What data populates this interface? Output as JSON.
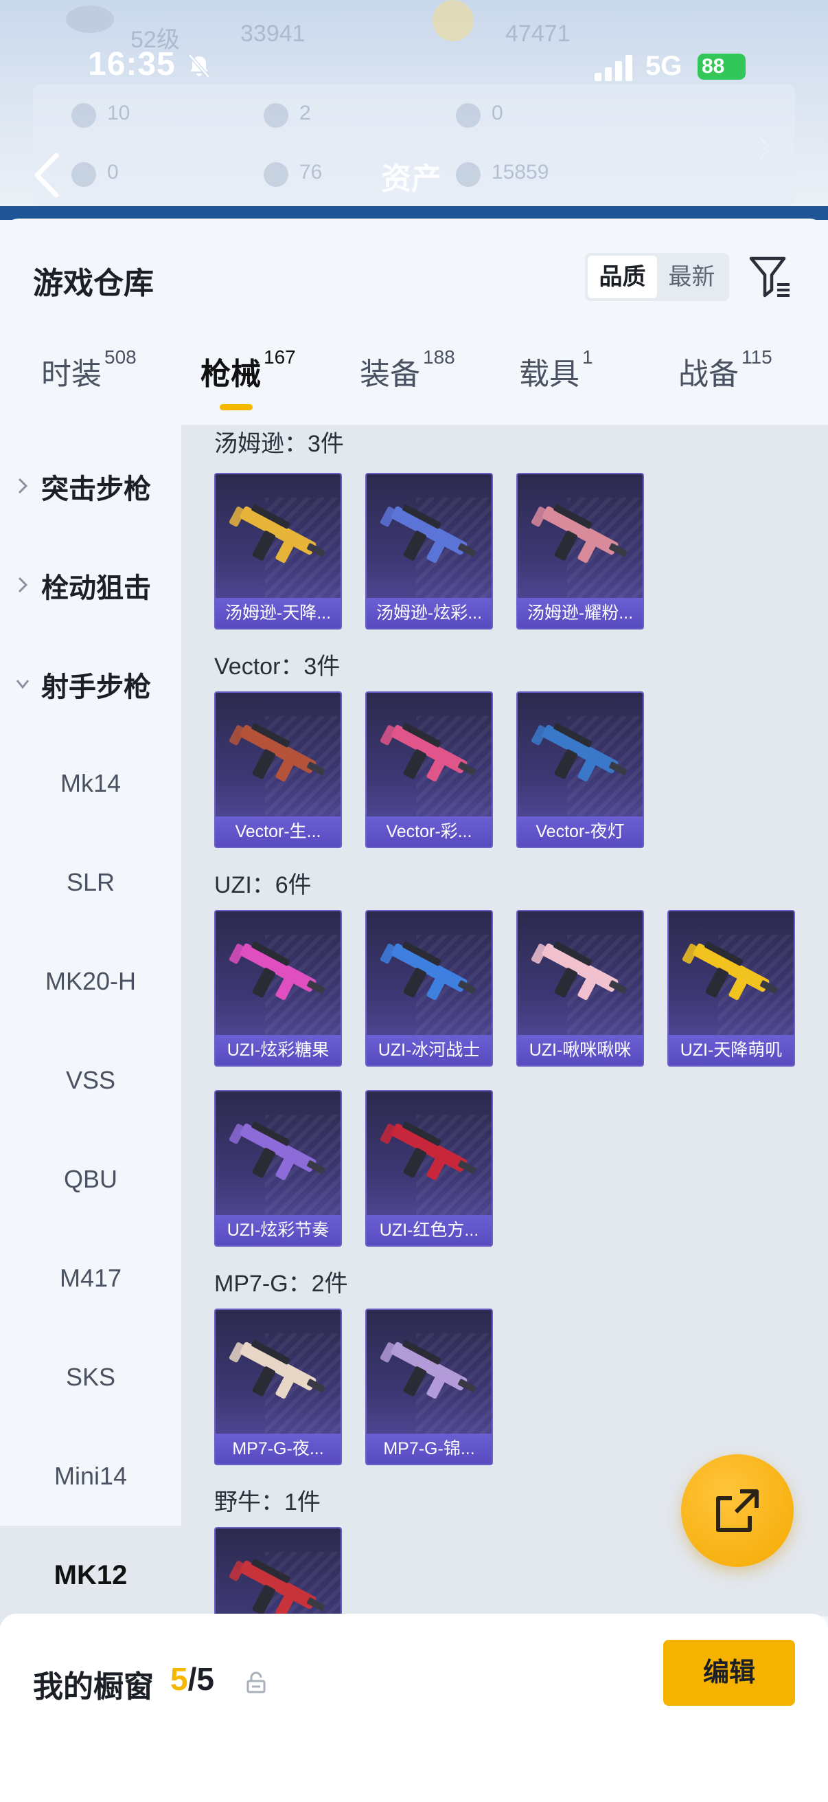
{
  "status_bar": {
    "time": "16:35",
    "network": "5G",
    "battery": "88"
  },
  "background_header": {
    "title": "资产",
    "ghost_level": "52级",
    "ghost_value_1": "33941",
    "ghost_value_2": "47471",
    "ghost_stats": [
      "10",
      "2",
      "0",
      "0",
      "76",
      "15859"
    ]
  },
  "warehouse": {
    "title": "游戏仓库",
    "sort_options": [
      "品质",
      "最新"
    ],
    "active_sort": "品质"
  },
  "tabs": [
    {
      "label": "时装",
      "count": "508"
    },
    {
      "label": "枪械",
      "count": "167"
    },
    {
      "label": "装备",
      "count": "188"
    },
    {
      "label": "载具",
      "count": "1"
    },
    {
      "label": "战备",
      "count": "115"
    }
  ],
  "active_tab": "枪械",
  "sidebar": {
    "groups": [
      "突击步枪",
      "栓动狙击",
      "射手步枪"
    ],
    "items": [
      "Mk14",
      "SLR",
      "MK20-H",
      "VSS",
      "QBU",
      "M417",
      "SKS",
      "Mini14",
      "MK12"
    ],
    "active_item": "MK12"
  },
  "sections": [
    {
      "title": "汤姆逊：3件",
      "items": [
        {
          "label": "汤姆逊-天降...",
          "icon": "gold-thompson-icon",
          "color": "#e7b43a"
        },
        {
          "label": "汤姆逊-炫彩...",
          "icon": "blue-thompson-icon",
          "color": "#5b74d8"
        },
        {
          "label": "汤姆逊-耀粉...",
          "icon": "pink-thompson-icon",
          "color": "#d98a9b"
        }
      ]
    },
    {
      "title": "Vector：3件",
      "items": [
        {
          "label": "Vector-生...",
          "icon": "vector-red-icon",
          "color": "#b5533a"
        },
        {
          "label": "Vector-彩...",
          "icon": "vector-colorful-icon",
          "color": "#e0558a"
        },
        {
          "label": "Vector-夜灯",
          "icon": "vector-night-icon",
          "color": "#3a79c9"
        }
      ]
    },
    {
      "title": "UZI：6件",
      "items": [
        {
          "label": "UZI-炫彩糖果",
          "icon": "uzi-candy-icon",
          "color": "#e04fc0"
        },
        {
          "label": "UZI-冰河战士",
          "icon": "uzi-ice-icon",
          "color": "#3e7fe0"
        },
        {
          "label": "UZI-啾咪啾咪",
          "icon": "uzi-pink-icon",
          "color": "#f1c1cf"
        },
        {
          "label": "UZI-天降萌叽",
          "icon": "uzi-gold-icon",
          "color": "#f2c21e"
        },
        {
          "label": "UZI-炫彩节奏",
          "icon": "uzi-rhythm-icon",
          "color": "#8d6bd8"
        },
        {
          "label": "UZI-红色方...",
          "icon": "uzi-red-icon",
          "color": "#c8263a"
        }
      ]
    },
    {
      "title": "MP7-G：2件",
      "items": [
        {
          "label": "MP7-G-夜...",
          "icon": "mp7-night-icon",
          "color": "#e8d6c6"
        },
        {
          "label": "MP7-G-锦...",
          "icon": "mp7-brocade-icon",
          "color": "#b39ad8"
        }
      ]
    },
    {
      "title": "野牛：1件",
      "items": [
        {
          "label": "",
          "icon": "bizon-red-icon",
          "color": "#c8323a"
        }
      ]
    }
  ],
  "showcase": {
    "label": "我的橱窗",
    "used": "5",
    "separator": "/",
    "total": "5",
    "edit_label": "编辑"
  },
  "colors": {
    "accent": "#f5b300",
    "card_bg": "#3d3874",
    "card_label": "#5b4fc4"
  }
}
